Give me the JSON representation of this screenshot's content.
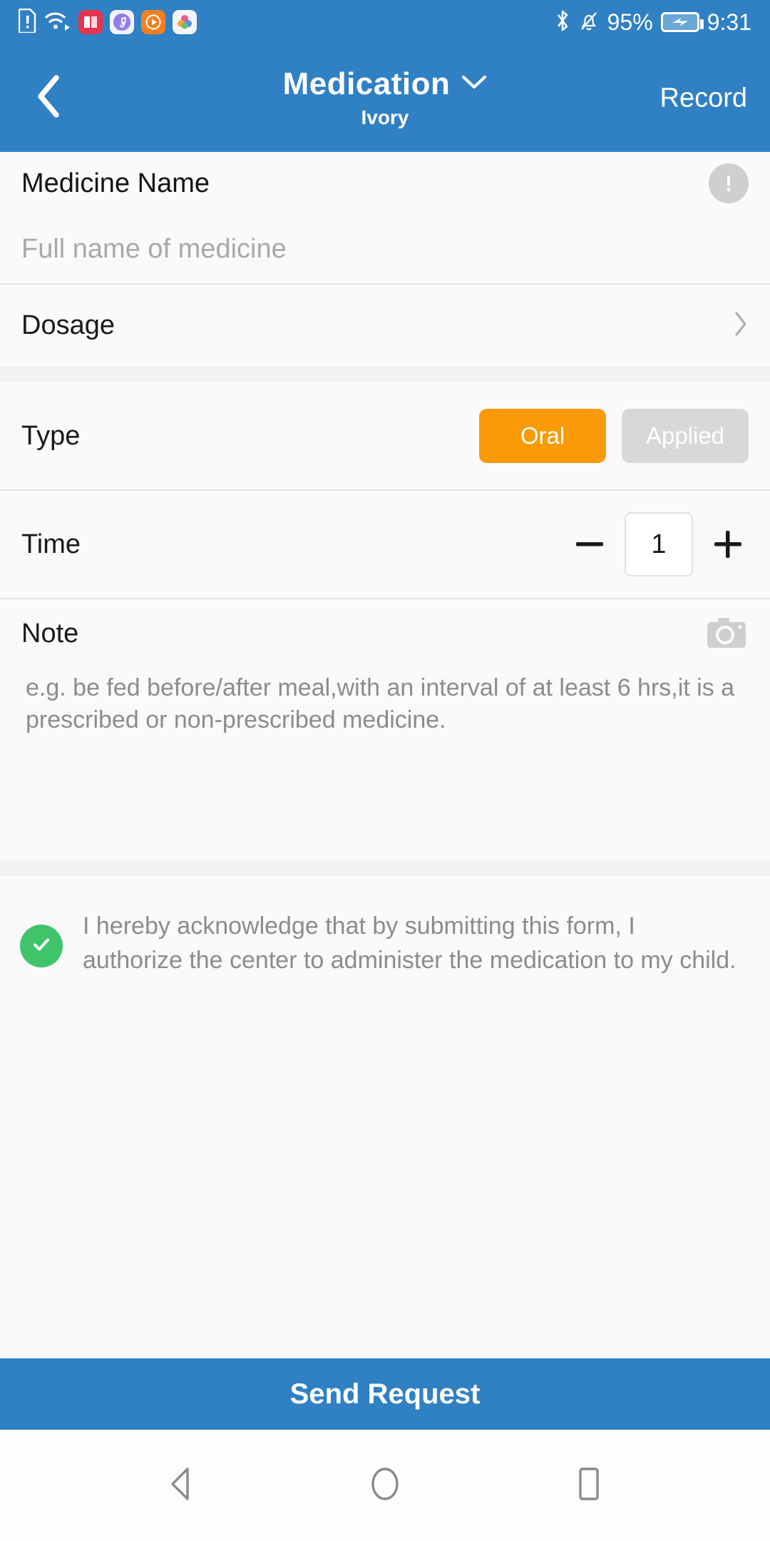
{
  "status_bar": {
    "left_icons": [
      "sim-alert-icon",
      "wifi-icon",
      "book-app-icon",
      "music-app-icon",
      "video-app-icon",
      "photos-app-icon"
    ],
    "bluetooth_icon": "bluetooth-icon",
    "silent_icon": "bell-muted-icon",
    "battery_percent": "95%",
    "battery_icon": "battery-charging-icon",
    "time": "9:31"
  },
  "app_bar": {
    "back_icon": "chevron-left-icon",
    "title": "Medication",
    "title_dropdown_icon": "chevron-down-icon",
    "subtitle": "Ivory",
    "record_label": "Record"
  },
  "form": {
    "medicine": {
      "label": "Medicine Name",
      "info_icon": "info-exclamation-icon",
      "placeholder": "Full name of medicine",
      "value": ""
    },
    "dosage": {
      "label": "Dosage",
      "chevron_icon": "chevron-right-icon",
      "value": ""
    },
    "type": {
      "label": "Type",
      "options": [
        "Oral",
        "Applied"
      ],
      "selected": "Oral"
    },
    "time": {
      "label": "Time",
      "decrement_icon": "minus-icon",
      "increment_icon": "plus-icon",
      "value": "1"
    },
    "note": {
      "label": "Note",
      "camera_icon": "camera-icon",
      "placeholder": "e.g. be fed before/after meal,with an interval of at least 6 hrs,it is a prescribed or non-prescribed medicine.",
      "value": ""
    },
    "consent": {
      "checked": true,
      "check_icon": "check-icon",
      "text": "I hereby acknowledge that by submitting this form, I authorize the center to administer the medication to my child."
    }
  },
  "submit": {
    "label": "Send Request"
  },
  "nav_bar": {
    "back_icon": "triangle-back-icon",
    "home_icon": "circle-home-icon",
    "recents_icon": "square-recents-icon"
  },
  "colors": {
    "header_blue": "#3080C4",
    "accent_orange": "#F99A06",
    "inactive_gray": "#D8D8D8",
    "check_green": "#3FC46A",
    "page_bg": "#FAFAFA"
  }
}
